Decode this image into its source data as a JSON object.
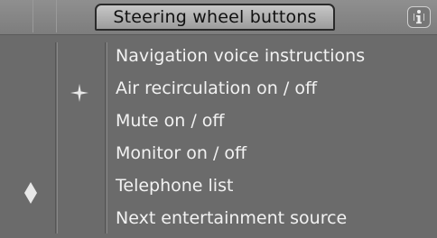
{
  "header": {
    "title": "Steering wheel buttons",
    "info_icon": "info-icon"
  },
  "menu": {
    "items": [
      {
        "label": "Navigation voice instructions"
      },
      {
        "label": "Air recirculation on / off",
        "marker": "star-icon"
      },
      {
        "label": "Mute on / off"
      },
      {
        "label": "Monitor on / off"
      },
      {
        "label": "Telephone list",
        "marker": "diamond-icon"
      },
      {
        "label": "Next entertainment source"
      }
    ]
  },
  "colors": {
    "background": "#6b6b6b",
    "text": "#f2f2f2",
    "title_tab": "#b5b5b5"
  }
}
